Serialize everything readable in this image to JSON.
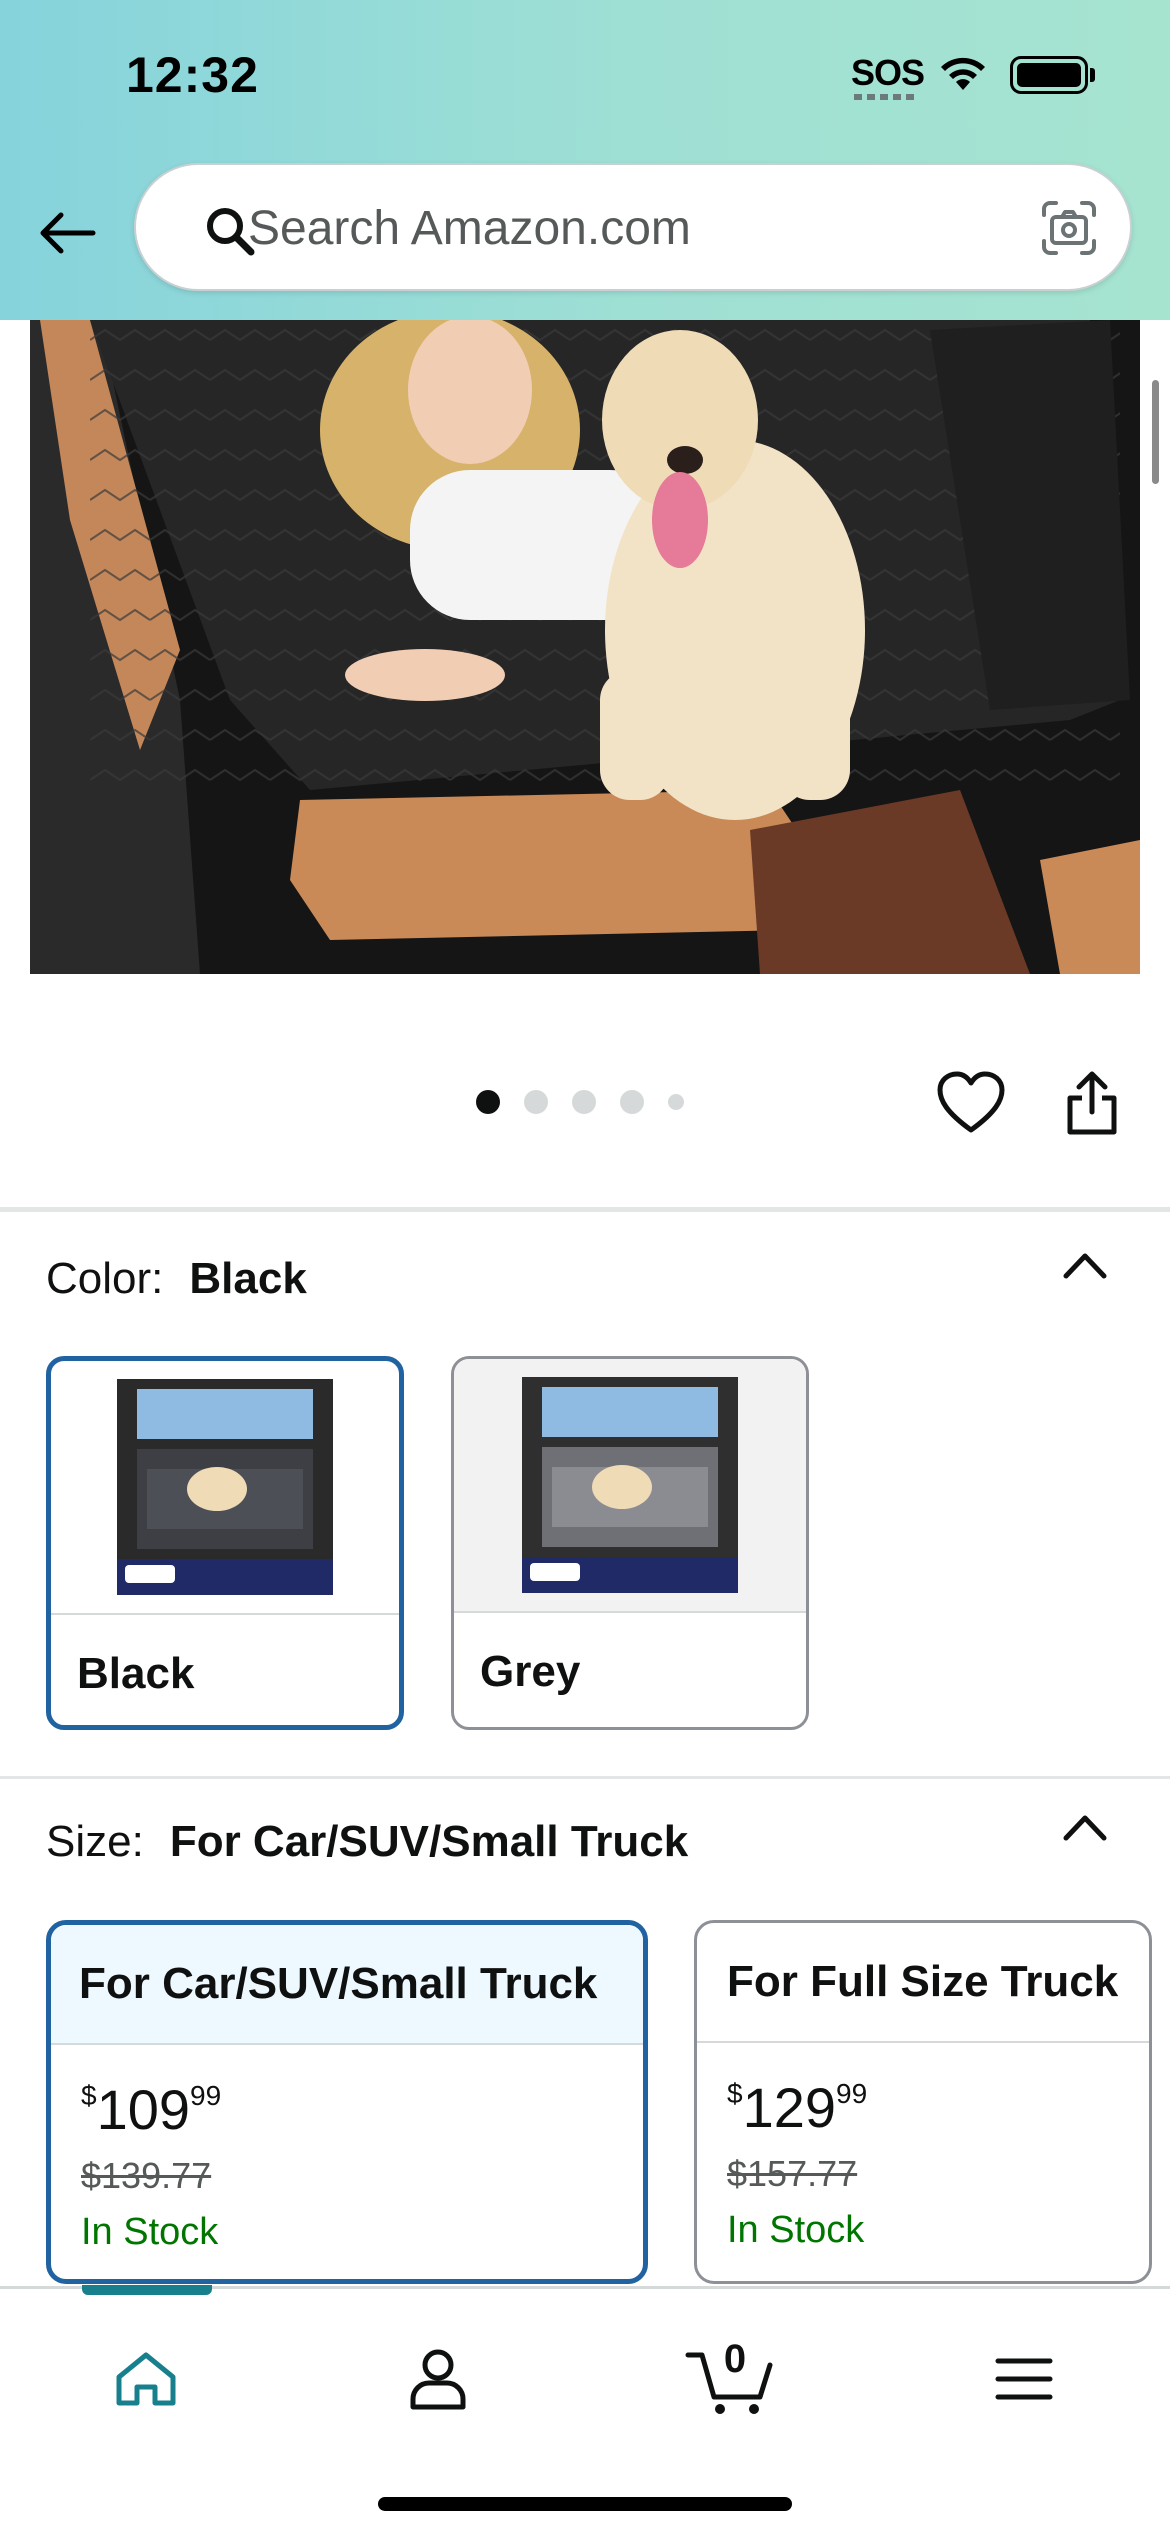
{
  "status_bar": {
    "time": "12:32",
    "sos_label": "SOS"
  },
  "search": {
    "placeholder": "Search Amazon.com"
  },
  "gallery": {
    "total_images": 5,
    "current_index": 1
  },
  "color_selector": {
    "label": "Color:",
    "selected": "Black",
    "options": [
      {
        "name": "Black",
        "selected": true
      },
      {
        "name": "Grey",
        "selected": false
      }
    ]
  },
  "size_selector": {
    "label": "Size:",
    "selected": "For Car/SUV/Small Truck",
    "options": [
      {
        "name": "For Car/SUV/Small Truck",
        "currency": "$",
        "price_whole": "109",
        "price_fraction": "99",
        "list_price": "$139.77",
        "availability": "In Stock",
        "selected": true
      },
      {
        "name": "For Full Size Truck",
        "currency": "$",
        "price_whole": "129",
        "price_fraction": "99",
        "list_price": "$157.77",
        "availability": "In Stock",
        "selected": false
      }
    ]
  },
  "bottom_nav": {
    "active": "home",
    "cart_count": "0",
    "items": [
      "home",
      "account",
      "cart",
      "menu"
    ]
  },
  "colors": {
    "header_gradient_start": "#86d3dc",
    "header_gradient_end": "#a6e4d0",
    "selected_border": "#2162a1",
    "in_stock": "#007600",
    "nav_active": "#18808d"
  }
}
